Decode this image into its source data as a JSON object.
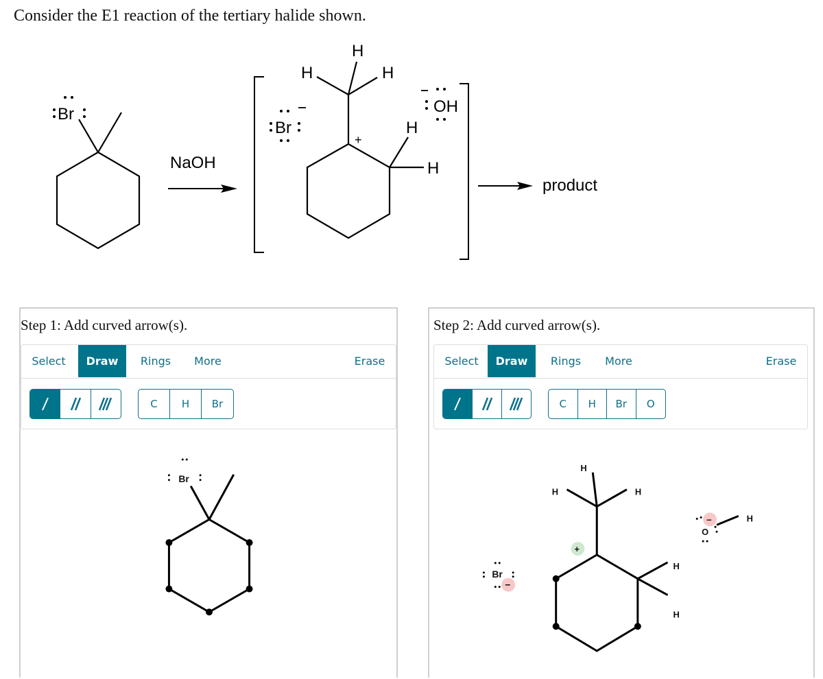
{
  "question": "Consider the E1 reaction of the tertiary halide shown.",
  "scheme": {
    "reagent": "NaOH",
    "product_label": "product",
    "reactant_atom": "Br",
    "intermediate_labels": {
      "bromide": "Br",
      "hydroxide": "OH",
      "hydrogen": "H",
      "plus": "+",
      "minus": "−"
    }
  },
  "panels": [
    {
      "title": "Step 1: Add curved arrow(s).",
      "tabs": [
        {
          "label": "Select",
          "active": false
        },
        {
          "label": "Draw",
          "active": true
        },
        {
          "label": "Rings",
          "active": false
        },
        {
          "label": "More",
          "active": false
        }
      ],
      "erase_label": "Erase",
      "bond_tools": [
        "single-bond",
        "double-bond",
        "triple-bond"
      ],
      "atom_tools": [
        "C",
        "H",
        "Br"
      ],
      "canvas_labels": {
        "br": "Br"
      }
    },
    {
      "title": "Step 2: Add curved arrow(s).",
      "tabs": [
        {
          "label": "Select",
          "active": false
        },
        {
          "label": "Draw",
          "active": true
        },
        {
          "label": "Rings",
          "active": false
        },
        {
          "label": "More",
          "active": false
        }
      ],
      "erase_label": "Erase",
      "bond_tools": [
        "single-bond",
        "double-bond",
        "triple-bond"
      ],
      "atom_tools": [
        "C",
        "H",
        "Br",
        "O"
      ],
      "canvas_labels": {
        "br": "Br",
        "o": "O",
        "h": "H",
        "plus": "+",
        "minus": "−"
      }
    }
  ],
  "colors": {
    "accent": "#00748b",
    "accent_text": "#0e6f8a",
    "positive_charge": "#cfe8cf",
    "negative_charge": "#f8c8c8"
  }
}
